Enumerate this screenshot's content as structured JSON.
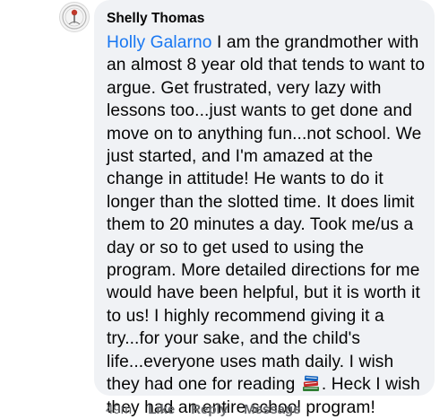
{
  "comment": {
    "author": "Shelly Thomas",
    "mention": "Holly Galarno",
    "body_part1": " I am the grandmother with an almost 8 year old that tends to want to argue. Get frustrated, very lazy with lessons too...just wants to get done and move on to anything fun...not school. We just started, and I'm amazed at the change in attitude! He wants to do it longer than the slotted time. It does limit them to 20 minutes a day. Took me/us a day or so to get used to using the program. More detailed directions for me would have been helpful, but it is worth it to us! I highly recommend giving it a try...for your sake, and the child's life...everyone uses math daily. I wish they had one for reading ",
    "emoji": "books-emoji",
    "body_part2": ". Heck I wish they had an entire school program!"
  },
  "actions": {
    "time": "49m",
    "like": "Like",
    "reply": "Reply",
    "message": "Message"
  },
  "colors": {
    "bubble": "#f0f2f5",
    "mention": "#1877f2",
    "meta": "#65676b",
    "text": "#050505"
  }
}
